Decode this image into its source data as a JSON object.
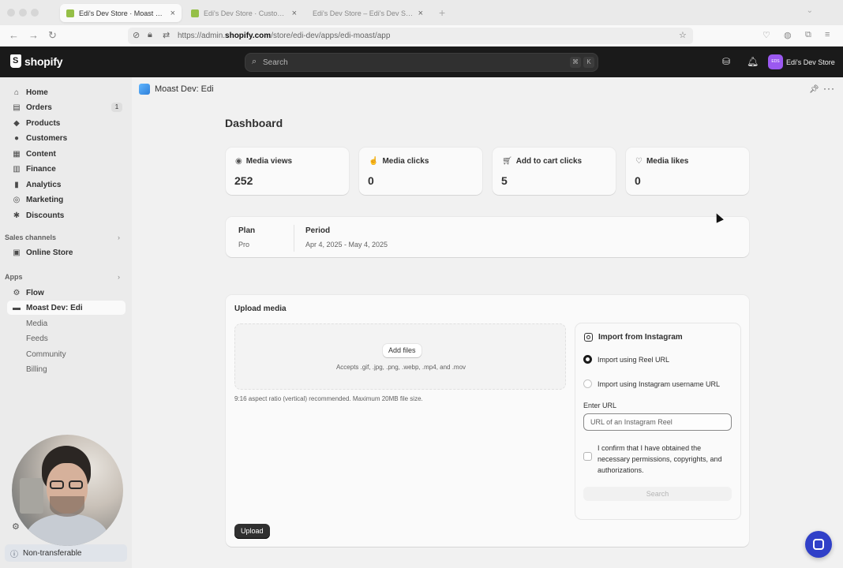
{
  "browser": {
    "tabs": [
      {
        "label": "Edi's Dev Store · Moast Dev: Edi",
        "active": true
      },
      {
        "label": "Edi's Dev Store · Customize ted",
        "active": false
      },
      {
        "label": "Edi's Dev Store – Edi's Dev Store",
        "active": false
      }
    ],
    "url_prefix": "https://admin.",
    "url_domain": "shopify.com",
    "url_path": "/store/edi-dev/apps/edi-moast/app"
  },
  "topbar": {
    "logo_text": "shopify",
    "search_placeholder": "Search",
    "shortcut_keys": [
      "⌘",
      "K"
    ],
    "store_initials": "EDS",
    "store_name": "Edi's Dev Store"
  },
  "sidebar": {
    "items": [
      {
        "label": "Home",
        "icon": "home-icon"
      },
      {
        "label": "Orders",
        "icon": "orders-icon",
        "badge": "1"
      },
      {
        "label": "Products",
        "icon": "tag-icon"
      },
      {
        "label": "Customers",
        "icon": "person-icon"
      },
      {
        "label": "Content",
        "icon": "content-icon"
      },
      {
        "label": "Finance",
        "icon": "bank-icon"
      },
      {
        "label": "Analytics",
        "icon": "chart-icon"
      },
      {
        "label": "Marketing",
        "icon": "target-icon"
      },
      {
        "label": "Discounts",
        "icon": "discount-icon"
      }
    ],
    "sales_channels_title": "Sales channels",
    "online_store": "Online Store",
    "apps_title": "Apps",
    "apps": [
      {
        "label": "Flow"
      },
      {
        "label": "Moast Dev: Edi",
        "selected": true
      }
    ],
    "subitems": [
      "Media",
      "Feeds",
      "Community",
      "Billing"
    ],
    "non_transferable": "Non-transferable"
  },
  "app": {
    "title": "Moast Dev: Edi"
  },
  "dashboard": {
    "title": "Dashboard",
    "stats": [
      {
        "label": "Media views",
        "value": "252",
        "icon": "eye-icon"
      },
      {
        "label": "Media clicks",
        "value": "0",
        "icon": "click-icon"
      },
      {
        "label": "Add to cart clicks",
        "value": "5",
        "icon": "cart-icon"
      },
      {
        "label": "Media likes",
        "value": "0",
        "icon": "heart-icon"
      }
    ],
    "plan_label": "Plan",
    "plan_value": "Pro",
    "period_label": "Period",
    "period_value": "Apr 4, 2025 - May 4, 2025"
  },
  "upload": {
    "title": "Upload media",
    "add_files": "Add files",
    "accepts": "Accepts .gif, .jpg, .png, .webp, .mp4, and .mov",
    "hint": "9:16 aspect ratio (vertical) recommended. Maximum 20MB file size.",
    "upload_button": "Upload",
    "instagram": {
      "title": "Import from Instagram",
      "option_reel": "Import using Reel URL",
      "option_username": "Import using Instagram username URL",
      "enter_url_label": "Enter URL",
      "url_placeholder": "URL of an Instagram Reel",
      "confirm_text": "I confirm that I have obtained the necessary permissions, copyrights, and authorizations.",
      "search_button": "Search"
    }
  },
  "colors": {
    "topbar": "#1a1a1a",
    "accent_chat": "#3040c8",
    "store_avatar": "#9b59f0"
  }
}
